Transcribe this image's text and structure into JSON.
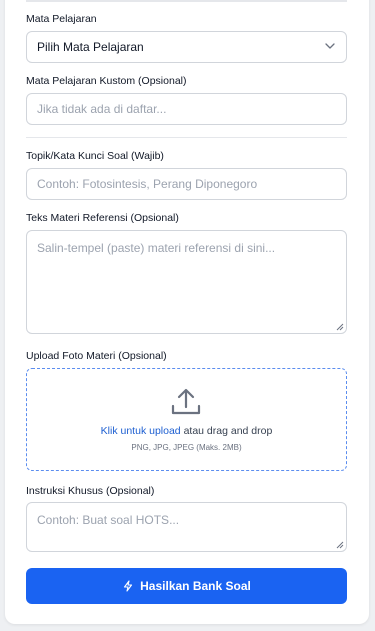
{
  "subject": {
    "label": "Mata Pelajaran",
    "selected": "Pilih Mata Pelajaran"
  },
  "custom_subject": {
    "label": "Mata Pelajaran Kustom (Opsional)",
    "placeholder": "Jika tidak ada di daftar..."
  },
  "topic": {
    "label": "Topik/Kata Kunci Soal (Wajib)",
    "placeholder": "Contoh: Fotosintesis, Perang Diponegoro"
  },
  "reference": {
    "label": "Teks Materi Referensi (Opsional)",
    "placeholder": "Salin-tempel (paste) materi referensi di sini..."
  },
  "upload": {
    "label": "Upload Foto Materi (Opsional)",
    "link_text": "Klik untuk upload",
    "rest_text": " atau drag and drop",
    "hint": "PNG, JPG, JPEG (Maks. 2MB)",
    "icon": "upload-icon"
  },
  "instructions": {
    "label": "Instruksi Khusus (Opsional)",
    "placeholder": "Contoh: Buat soal HOTS..."
  },
  "submit": {
    "label": "Hasilkan Bank Soal",
    "icon": "lightning-icon"
  },
  "colors": {
    "primary": "#1a63f2",
    "link": "#1d5fd1",
    "dashed_border": "#5b8def"
  }
}
